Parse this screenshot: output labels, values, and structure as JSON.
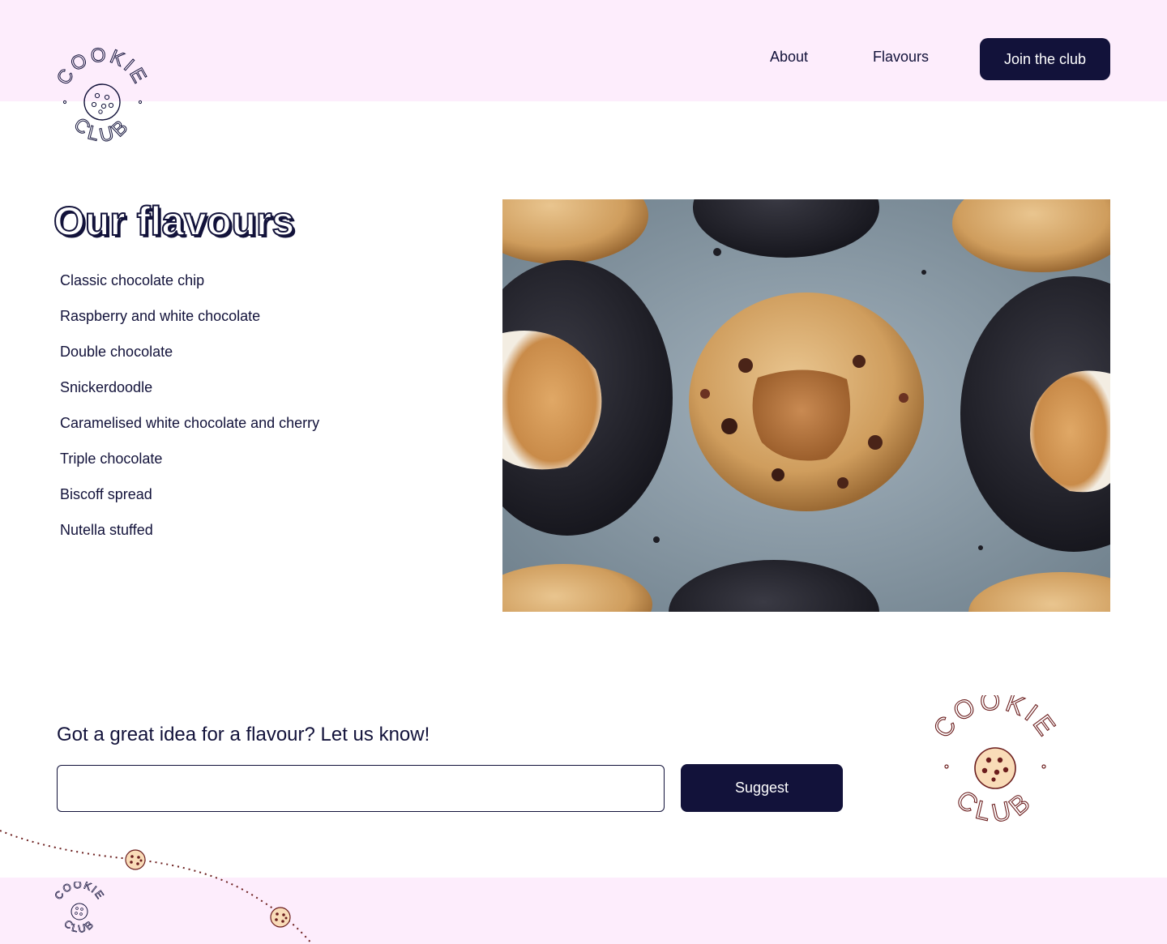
{
  "header": {
    "logo_top_word": "COOKIE",
    "logo_bottom_word": "CLUB",
    "nav": {
      "about": "About",
      "flavours": "Flavours",
      "join": "Join the club"
    }
  },
  "main": {
    "title": "Our flavours",
    "flavours": [
      "Classic chocolate chip",
      "Raspberry and white chocolate",
      "Double chocolate",
      "Snickerdoodle",
      "Caramelised white chocolate and cherry",
      "Triple chocolate",
      "Biscoff spread",
      "Nutella stuffed"
    ],
    "hero_image_icon": "cookies-photo"
  },
  "suggest": {
    "heading": "Got a great idea for a flavour? Let us know!",
    "input_value": "",
    "input_placeholder": "",
    "button": "Suggest"
  },
  "colors": {
    "navy": "#12123a",
    "pink_bg": "#fdedfc",
    "brown": "#6b1d1d",
    "cookie_fill": "#f9dcb8"
  }
}
